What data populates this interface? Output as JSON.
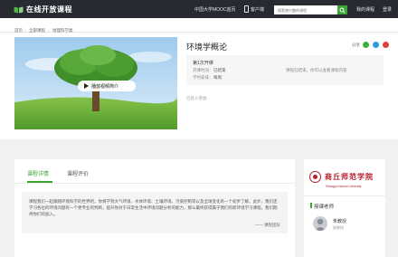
{
  "header": {
    "logo_text": "在线开放课程",
    "nav_mooc": "中国大学MOOC首页",
    "nav_client": "客户端",
    "search_placeholder": "搜索感兴趣的课程",
    "nav_my_course": "我的课程",
    "nav_login": "登录"
  },
  "breadcrumb": [
    "首页",
    "全部课程",
    "地理科学类"
  ],
  "course": {
    "title": "环境学概论",
    "play_label": "播放视频简介",
    "share_label": "分享",
    "term": "第1次开课",
    "date_label": "开课时间：",
    "date_value": "已结束",
    "note": "课程已结束，你可以查看课程内容",
    "workload_label": "学时安排：",
    "workload_value": "每周",
    "enrolled": "已有人参加"
  },
  "tabs": [
    {
      "label": "课程详情",
      "active": true
    },
    {
      "label": "课程评价",
      "active": false
    }
  ],
  "intro": {
    "text": "课程我们一起跟随环境科学的世界吧，你将学到大气环境、水体环境、土壤环境、污染控制等以及全球变化有一个初步了解。此外，我们还学习各位的环境问题有一个更专业的判断，提升你对于日常生活中环境问题分析的能力，那么最终获得属于我们的新环境学习课程，我们期待你们的加入。",
    "signature": "—— 课程团队"
  },
  "school": {
    "name": "商丘师范学院",
    "name_en": "Shangqiu Normal University"
  },
  "teachers": {
    "heading": "授课老师",
    "list": [
      {
        "name": "朱教授",
        "role": "副教授"
      }
    ]
  },
  "colors": {
    "accent": "#39a634",
    "topbar": "#272a31",
    "school": "#b3202e"
  }
}
